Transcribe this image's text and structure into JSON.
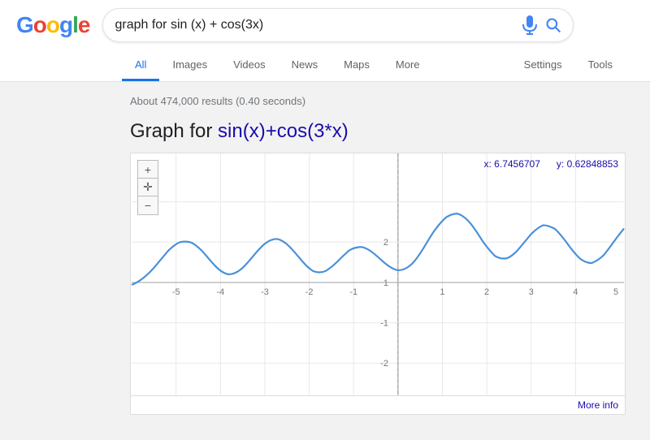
{
  "header": {
    "logo": {
      "g": "G",
      "o1": "o",
      "o2": "o",
      "g2": "g",
      "l": "l",
      "e": "e"
    },
    "search": {
      "value": "graph for sin (x) + cos(3x)",
      "placeholder": "Search"
    },
    "nav": {
      "tabs": [
        {
          "label": "All",
          "active": true
        },
        {
          "label": "Images",
          "active": false
        },
        {
          "label": "Videos",
          "active": false
        },
        {
          "label": "News",
          "active": false
        },
        {
          "label": "Maps",
          "active": false
        },
        {
          "label": "More",
          "active": false
        }
      ],
      "right_tabs": [
        {
          "label": "Settings",
          "active": false
        },
        {
          "label": "Tools",
          "active": false
        }
      ]
    }
  },
  "main": {
    "results_count": "About 474,000 results (0.40 seconds)",
    "graph_heading_static": "Graph for ",
    "graph_heading_link": "sin(x)+cos(3*x)",
    "graph_coords": {
      "x_label": "x: 6.7456707",
      "y_label": "y: 0.62848853"
    },
    "more_info_label": "More info"
  },
  "controls": {
    "zoom_in": "+",
    "move": "✛",
    "zoom_out": "−"
  }
}
